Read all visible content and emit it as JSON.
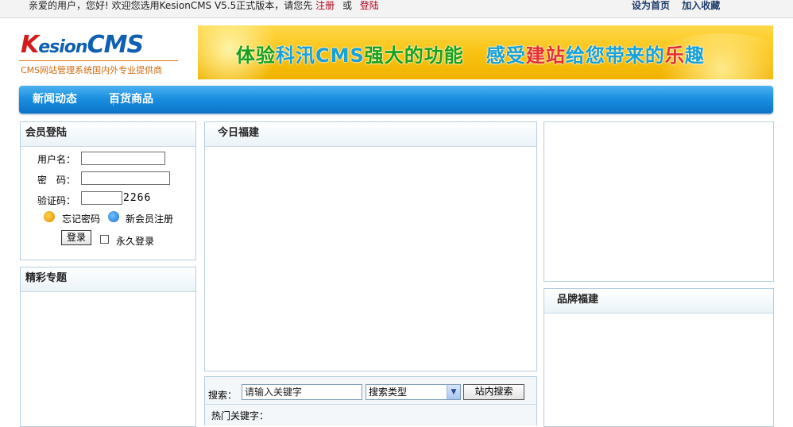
{
  "topbar": {
    "welcome": "亲爱的用户，您好! 欢迎您选用KesionCMS V5.5正式版本，请您先",
    "register_link": "注册",
    "or_text": "或",
    "login_link": "登陆",
    "set_home": "设为首页",
    "add_favorite": "加入收藏"
  },
  "logo": {
    "brand_k": "K",
    "brand_mid": "esion",
    "brand_cms": "CMS",
    "tagline": "CMS网站管理系统国内外专业提供商"
  },
  "banner": {
    "part1": "体验",
    "part2": "科汛CMS",
    "part3": "强大的功能",
    "part4": "感受",
    "part5": "建站",
    "part6": "给您带来的",
    "part7": "乐",
    "part8": "趣"
  },
  "nav": {
    "items": [
      "新闻动态",
      "百货商品"
    ]
  },
  "login": {
    "title": "会员登陆",
    "username_label": "用户名：",
    "password_label": "密　码：",
    "captcha_label": "验证码：",
    "captcha_code": "2266",
    "forgot_password": "忘记密码",
    "register": "新会员注册",
    "login_button": "登录",
    "remember": "永久登录"
  },
  "featured": {
    "title": "精彩专题"
  },
  "today": {
    "title": "今日福建"
  },
  "brand_box": {
    "title": "品牌福建"
  },
  "search": {
    "label": "搜索：",
    "keyword_placeholder": "请输入关键字",
    "type_selected": "搜索类型",
    "button": "站内搜索",
    "hot_keywords": "热门关键字："
  },
  "colors": {
    "nav_blue": "#1b8fe0",
    "link_red": "#b3001a",
    "banner_yellow": "#f9c313"
  }
}
